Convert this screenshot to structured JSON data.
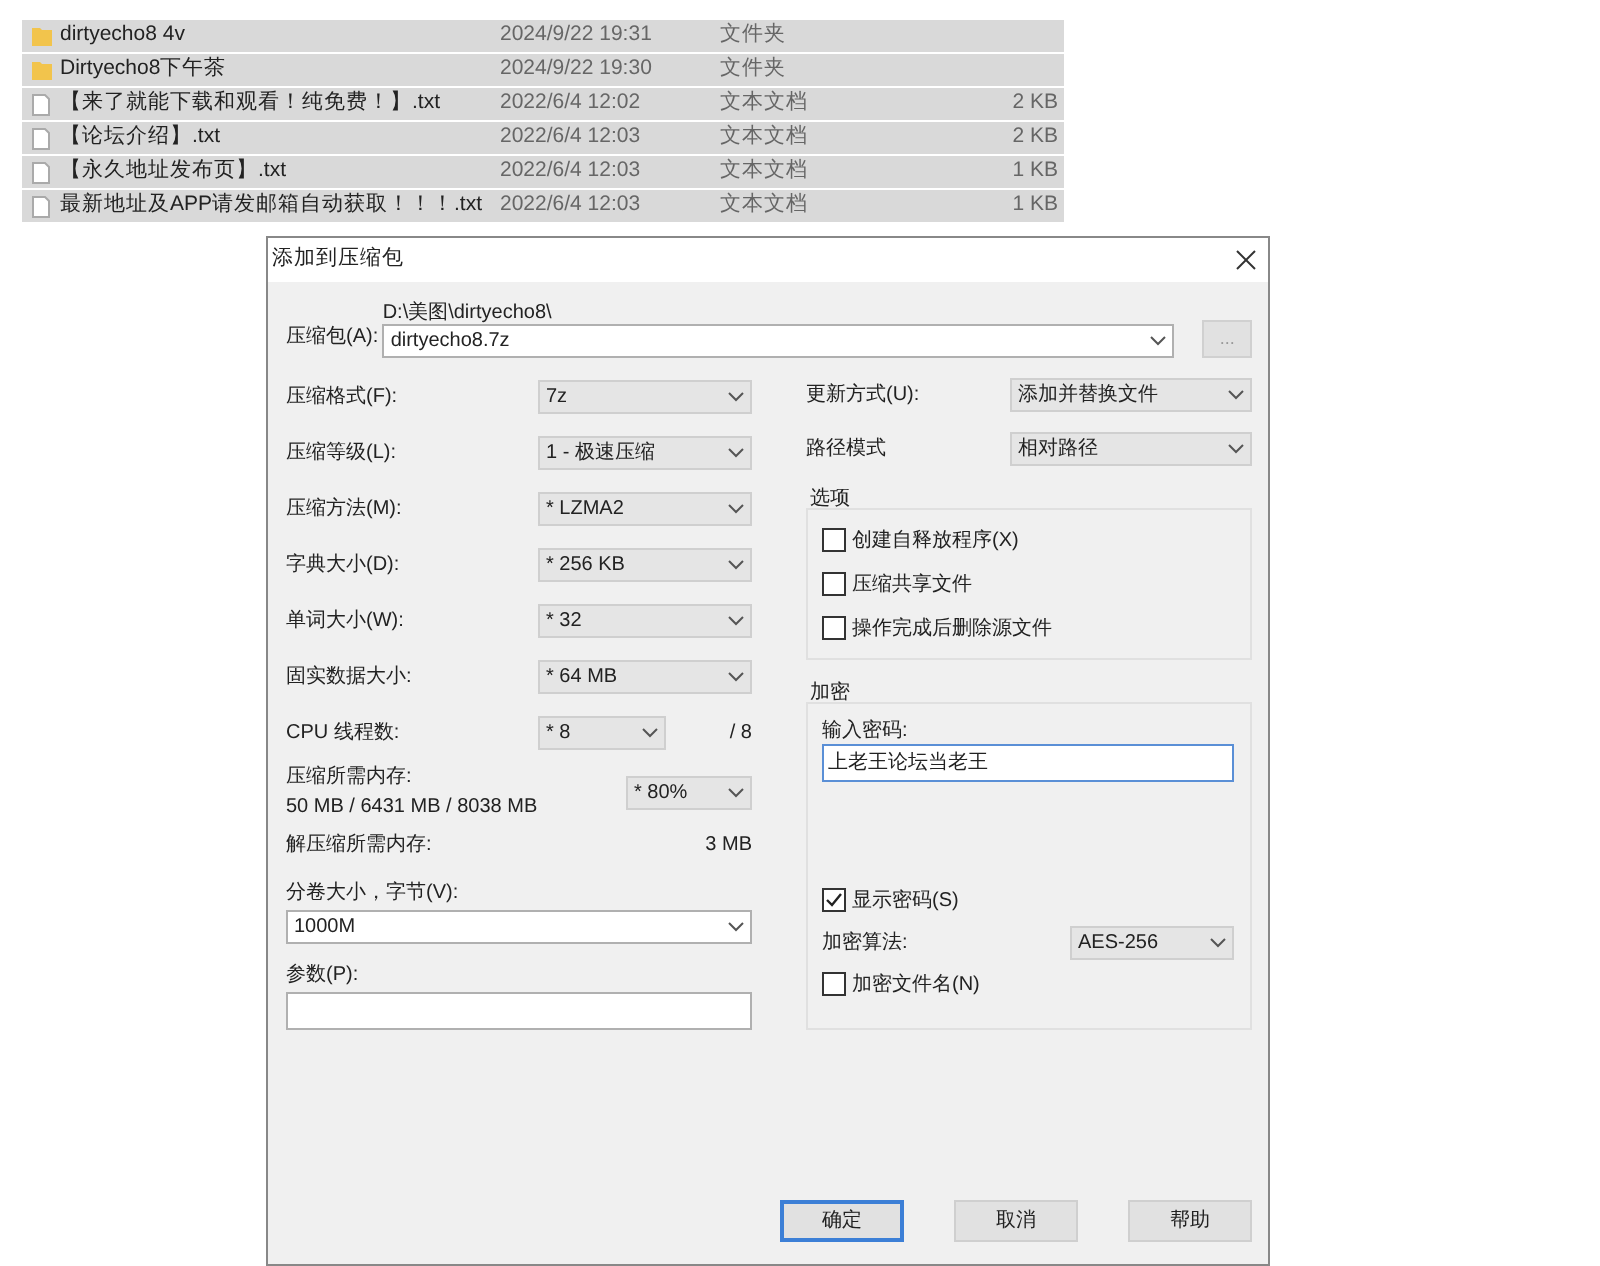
{
  "files": [
    {
      "kind": "folder",
      "name": "dirtyecho8 4v",
      "date": "2024/9/22 19:31",
      "type": "文件夹",
      "selected": true
    },
    {
      "kind": "folder",
      "name": "Dirtyecho8下午茶",
      "date": "2024/9/22 19:30",
      "type": "文件夹",
      "selected": true
    },
    {
      "kind": "file",
      "name": "【来了就能下载和观看！纯免费！】.txt",
      "date": "2022/6/4 12:02",
      "type": "文本文档",
      "size": "2 KB",
      "selected": true
    },
    {
      "kind": "file",
      "name": "【论坛介绍】.txt",
      "date": "2022/6/4 12:03",
      "type": "文本文档",
      "size": "2 KB",
      "selected": true
    },
    {
      "kind": "file",
      "name": "【永久地址发布页】.txt",
      "date": "2022/6/4 12:03",
      "type": "文本文档",
      "size": "1 KB",
      "selected": true
    },
    {
      "kind": "file",
      "name": "最新地址及APP请发邮箱自动获取！！！.txt",
      "date": "2022/6/4 12:03",
      "type": "文本文档",
      "size": "1 KB",
      "selected": true
    }
  ],
  "dialog": {
    "title": "添加到压缩包",
    "archive": {
      "label": "压缩包(A):",
      "path": "D:\\美图\\dirtyecho8\\",
      "value": "dirtyecho8.7z",
      "browse": "..."
    },
    "settings": [
      {
        "label": "压缩格式(F):",
        "value": "7z"
      },
      {
        "label": "压缩等级(L):",
        "value": "1 - 极速压缩"
      },
      {
        "label": "压缩方法(M):",
        "value": "* LZMA2"
      },
      {
        "label": "字典大小(D):",
        "value": "* 256 KB"
      },
      {
        "label": "单词大小(W):",
        "value": "* 32"
      },
      {
        "label": "固实数据大小:",
        "value": "* 64 MB"
      }
    ],
    "cpu": {
      "label": "CPU 线程数:",
      "value": "* 8",
      "max": "/ 8"
    },
    "memory": {
      "label": "压缩所需内存:",
      "detail": "50 MB / 6431 MB / 8038 MB",
      "value": "* 80%"
    },
    "decompress_memory": {
      "label": "解压缩所需内存:",
      "value": "3 MB"
    },
    "volume": {
      "label": "分卷大小，字节(V):",
      "value": "1000M"
    },
    "parameters": {
      "label": "参数(P):"
    },
    "update_mode": {
      "label": "更新方式(U):",
      "value": "添加并替换文件"
    },
    "path_mode": {
      "label": "路径模式",
      "value": "相对路径"
    },
    "options": {
      "title": "选项",
      "items": [
        {
          "label": "创建自释放程序(X)",
          "checked": false
        },
        {
          "label": "压缩共享文件",
          "checked": false
        },
        {
          "label": "操作完成后删除源文件",
          "checked": false
        }
      ]
    },
    "encryption": {
      "title": "加密",
      "password_label": "输入密码:",
      "password": "上老王论坛当老王",
      "show_password": {
        "label": "显示密码(S)",
        "checked": true
      },
      "method": {
        "label": "加密算法:",
        "value": "AES-256"
      },
      "encrypt_names": {
        "label": "加密文件名(N)",
        "checked": false
      }
    },
    "buttons": [
      {
        "label": "确定",
        "default": true
      },
      {
        "label": "取消",
        "default": false
      },
      {
        "label": "帮助",
        "default": false
      }
    ]
  }
}
